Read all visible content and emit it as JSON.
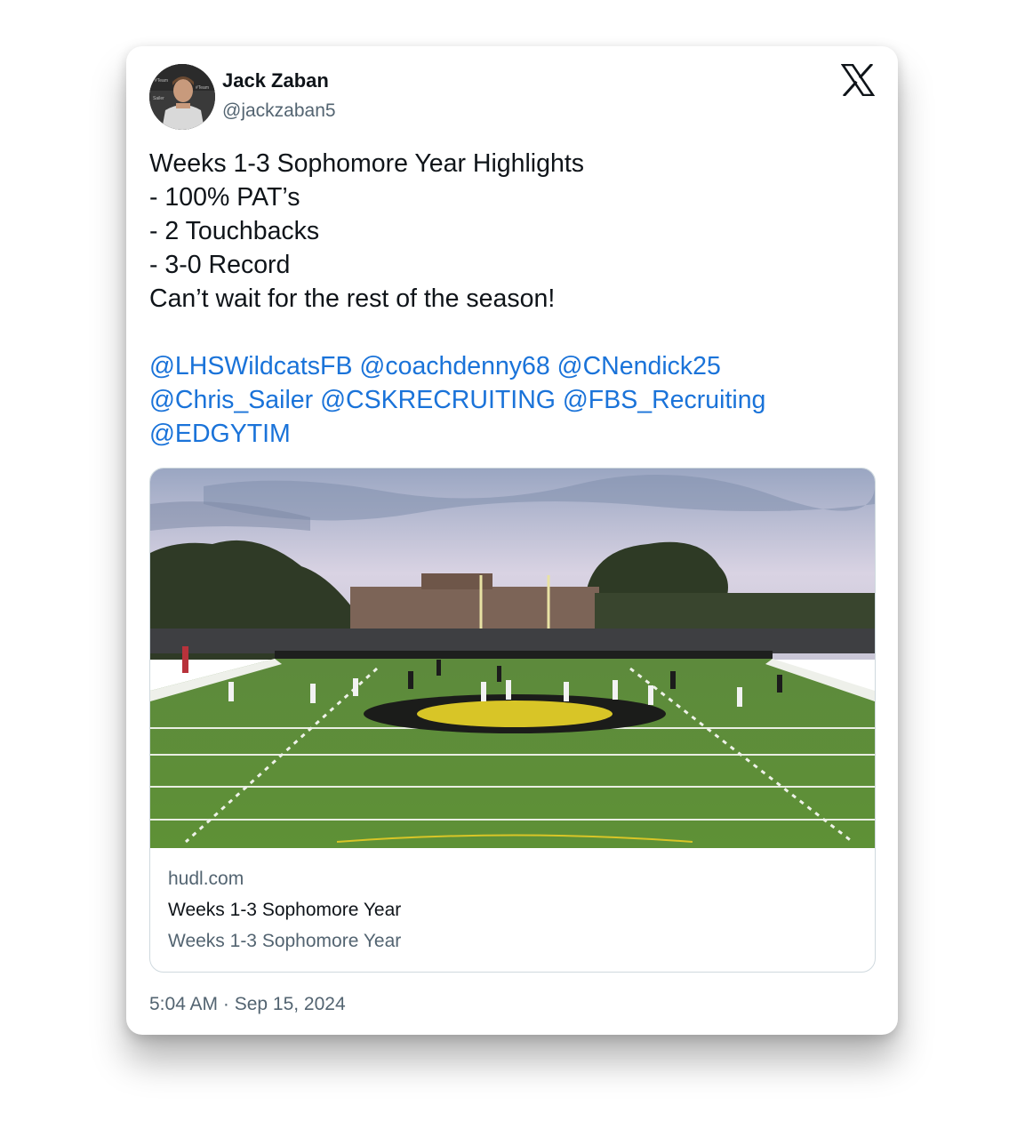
{
  "author": {
    "name": "Jack Zaban",
    "handle": "@jackzaban5"
  },
  "tweet": {
    "lines": [
      "Weeks 1-3 Sophomore Year Highlights",
      "- 100% PAT’s",
      "- 2 Touchbacks",
      "- 3-0 Record",
      "Can’t wait for the rest of the season!"
    ],
    "mentions": [
      "@LHSWildcatsFB",
      "@coachdenny68",
      "@CNendick25",
      "@Chris_Sailer",
      "@CSKRECRUITING",
      "@FBS_Recruiting",
      "@EDGYTIM"
    ]
  },
  "link_card": {
    "domain": "hudl.com",
    "title": "Weeks 1-3 Sophomore Year",
    "description": "Weeks 1-3 Sophomore Year"
  },
  "timestamp": "5:04 AM · Sep 15, 2024",
  "icons": {
    "logo": "x-logo-icon",
    "avatar": "profile-photo"
  },
  "colors": {
    "link": "#1a73d9",
    "text": "#0f1419",
    "muted": "#536471",
    "card_border": "#cfd9de"
  }
}
